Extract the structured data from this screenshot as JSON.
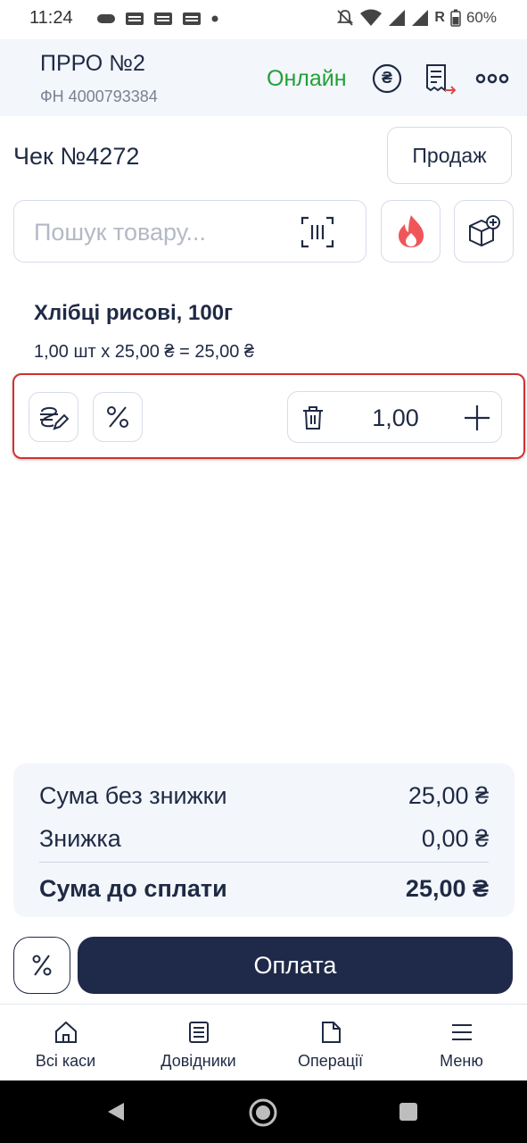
{
  "status_bar": {
    "time": "11:24",
    "battery": "60%",
    "roaming": "R"
  },
  "header": {
    "title": "ПРРО №2",
    "fiscal_number": "ФН 4000793384",
    "status": "Онлайн",
    "currency_symbol": "₴"
  },
  "receipt": {
    "title": "Чек №4272",
    "mode_button": "Продаж"
  },
  "search": {
    "placeholder": "Пошук товару..."
  },
  "item": {
    "name": "Хлібці рисові, 100г",
    "calc": "1,00 шт x 25,00 ₴ = 25,00 ₴",
    "quantity": "1,00"
  },
  "summary": {
    "subtotal_label": "Сума без знижки",
    "subtotal_value": "25,00 ₴",
    "discount_label": "Знижка",
    "discount_value": "0,00 ₴",
    "total_label": "Сума до сплати",
    "total_value": "25,00 ₴"
  },
  "actions": {
    "pay_label": "Оплата"
  },
  "bottom_nav": [
    {
      "label": "Всі каси",
      "icon": "home-icon"
    },
    {
      "label": "Довідники",
      "icon": "list-icon"
    },
    {
      "label": "Операції",
      "icon": "document-icon"
    },
    {
      "label": "Меню",
      "icon": "menu-icon"
    }
  ],
  "colors": {
    "accent_dark": "#1f2a4a",
    "online_green": "#21a038",
    "highlight_red": "#d03030",
    "fire_red": "#f0555a"
  }
}
